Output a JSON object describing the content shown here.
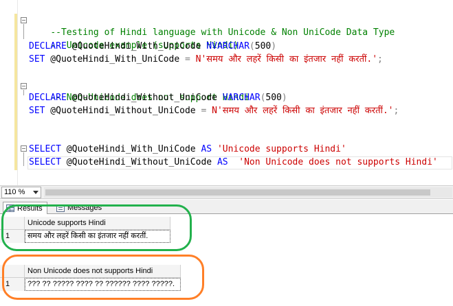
{
  "editor": {
    "lines": [
      {
        "comment": "--Testing of Hindi language with Unicode & Non UniCode Data Type"
      },
      {
        "comment": "-- Unicode example (supports Hindi)"
      },
      {
        "kw1": "DECLARE",
        "var": " @QuoteHindi_With_UniCode ",
        "kw2": "NVARCHAR",
        "p1": "(",
        "num": "500",
        "p2": ")"
      },
      {
        "kw1": "SET",
        "var": " @QuoteHindi_With_UniCode ",
        "op": "=",
        "str": " N'समय और लहरें किसी का इंतजार नहीं करतीं.'",
        "end": ";"
      },
      {
        "comment": "-- Non-Unicode does not support Hindi"
      },
      {
        "kw1": "DECLARE",
        "var": " @QuoteHindi_Without_UniCode ",
        "kw2": "VARCHAR",
        "p1": "(",
        "num": "500",
        "p2": ")"
      },
      {
        "kw1": "SET",
        "var": " @QuoteHindi_Without_UniCode ",
        "op": "=",
        "str": " N'समय और लहरें किसी का इंतजार नहीं करतीं.'",
        "end": ";"
      },
      {
        "kw1": "SELECT",
        "var": " @QuoteHindi_With_UniCode ",
        "kw2": "AS",
        "str": " 'Unicode supports Hindi'"
      },
      {
        "kw1": "SELECT",
        "var": " @QuoteHindi_Without_UniCode ",
        "kw2": "AS",
        "str": "  'Non Unicode does not supports Hindi'"
      }
    ]
  },
  "zoom": {
    "value": "110 %"
  },
  "tabs": {
    "results": "Results",
    "messages": "Messages"
  },
  "grids": [
    {
      "column": "Unicode supports Hindi",
      "row_number": "1",
      "value": "समय और लहरें किसी का इंतजार नहीं करतीं."
    },
    {
      "column": "Non Unicode does not supports Hindi",
      "row_number": "1",
      "value": "??? ?? ????? ???? ?? ?????? ???? ?????."
    }
  ],
  "colors": {
    "annotation_green": "#22b14c",
    "annotation_orange": "#ff7f27",
    "keyword": "#0000ff",
    "comment": "#008000",
    "string": "#cc0000"
  }
}
